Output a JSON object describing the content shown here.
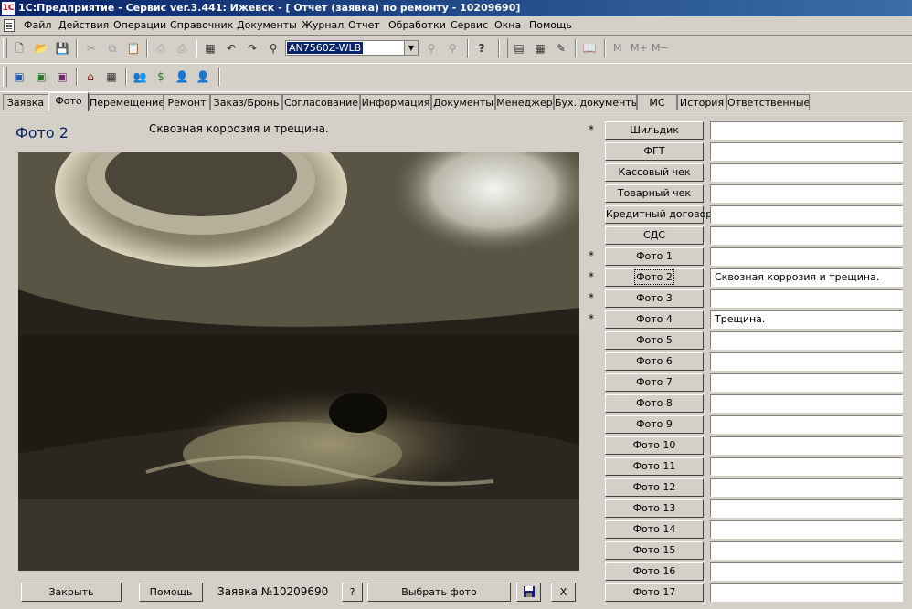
{
  "window": {
    "title": "1С:Предприятие - Сервис ver.3.441: Ижевск - [ Отчет (заявка) по ремонту - 10209690]"
  },
  "menu": [
    "Файл",
    "Действия",
    "Операции",
    "Справочник",
    "Документы",
    "Журнал",
    "Отчет",
    "Обработки",
    "Сервис",
    "Окна",
    "Помощь"
  ],
  "toolbar": {
    "search_value": "AN7560Z-WLB",
    "memory_buttons": [
      "M",
      "M+",
      "M−"
    ],
    "icons_row1": [
      "new-document-icon",
      "open-folder-icon",
      "save-icon",
      "cut-icon",
      "copy-icon",
      "paste-icon",
      "print-icon",
      "print-preview-icon",
      "calendar-icon",
      "undo-icon",
      "redo-icon",
      "binoculars-icon",
      "search-next-icon",
      "search-prev-icon",
      "help-icon",
      "calculator-icon",
      "table-icon",
      "dictionary-icon",
      "book-icon"
    ],
    "icons_row2": [
      "cube-blue-icon",
      "cube-green-icon",
      "cube-window-icon",
      "house-icon",
      "grid-icon",
      "people-icon",
      "currency-icon",
      "person-red-icon",
      "person-exit-icon"
    ]
  },
  "tabs": [
    "Заявка",
    "Фото",
    "Перемещение",
    "Ремонт",
    "Заказ/Бронь",
    "Согласование",
    "Информация",
    "Документы",
    "Менеджер",
    "Бух. документы",
    "МС",
    "История",
    "Ответственные"
  ],
  "active_tab": "Фото",
  "photo": {
    "title": "Фото 2",
    "description": "Сквозная коррозия и трещина."
  },
  "bottom": {
    "close_label": "Закрыть",
    "help_label": "Помощь",
    "order_label": "Заявка №10209690",
    "question_label": "?",
    "select_photo_label": "Выбрать фото",
    "close_x_label": "X"
  },
  "side_items": [
    {
      "star": "*",
      "label": "Шильдик",
      "value": ""
    },
    {
      "star": "",
      "label": "ФГТ",
      "value": ""
    },
    {
      "star": "",
      "label": "Кассовый чек",
      "value": ""
    },
    {
      "star": "",
      "label": "Товарный чек",
      "value": ""
    },
    {
      "star": "",
      "label": "Кредитный договор",
      "value": ""
    },
    {
      "star": "",
      "label": "СДС",
      "value": ""
    },
    {
      "star": "*",
      "label": "Фото 1",
      "value": ""
    },
    {
      "star": "*",
      "label": "Фото 2",
      "value": "Сквозная коррозия и трещина."
    },
    {
      "star": "*",
      "label": "Фото 3",
      "value": ""
    },
    {
      "star": "*",
      "label": "Фото 4",
      "value": "Трещина."
    },
    {
      "star": "",
      "label": "Фото 5",
      "value": ""
    },
    {
      "star": "",
      "label": "Фото 6",
      "value": ""
    },
    {
      "star": "",
      "label": "Фото 7",
      "value": ""
    },
    {
      "star": "",
      "label": "Фото 8",
      "value": ""
    },
    {
      "star": "",
      "label": "Фото 9",
      "value": ""
    },
    {
      "star": "",
      "label": "Фото 10",
      "value": ""
    },
    {
      "star": "",
      "label": "Фото 11",
      "value": ""
    },
    {
      "star": "",
      "label": "Фото 12",
      "value": ""
    },
    {
      "star": "",
      "label": "Фото 13",
      "value": ""
    },
    {
      "star": "",
      "label": "Фото 14",
      "value": ""
    },
    {
      "star": "",
      "label": "Фото 15",
      "value": ""
    },
    {
      "star": "",
      "label": "Фото 16",
      "value": ""
    },
    {
      "star": "",
      "label": "Фото 17",
      "value": ""
    }
  ],
  "colors": {
    "accent": "#0a246a",
    "face": "#d4d0c8"
  }
}
